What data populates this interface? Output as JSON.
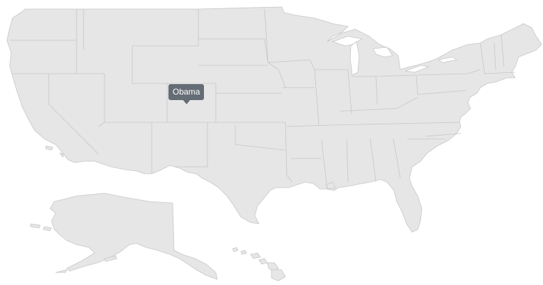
{
  "map": {
    "fill_color": "#e6e6e6",
    "border_color": "#c6c6c6",
    "regions": [
      "contiguous-us",
      "alaska",
      "hawaii"
    ]
  },
  "tooltip": {
    "label": "Obama",
    "background": "#646d76",
    "text_color": "#ffffff"
  }
}
